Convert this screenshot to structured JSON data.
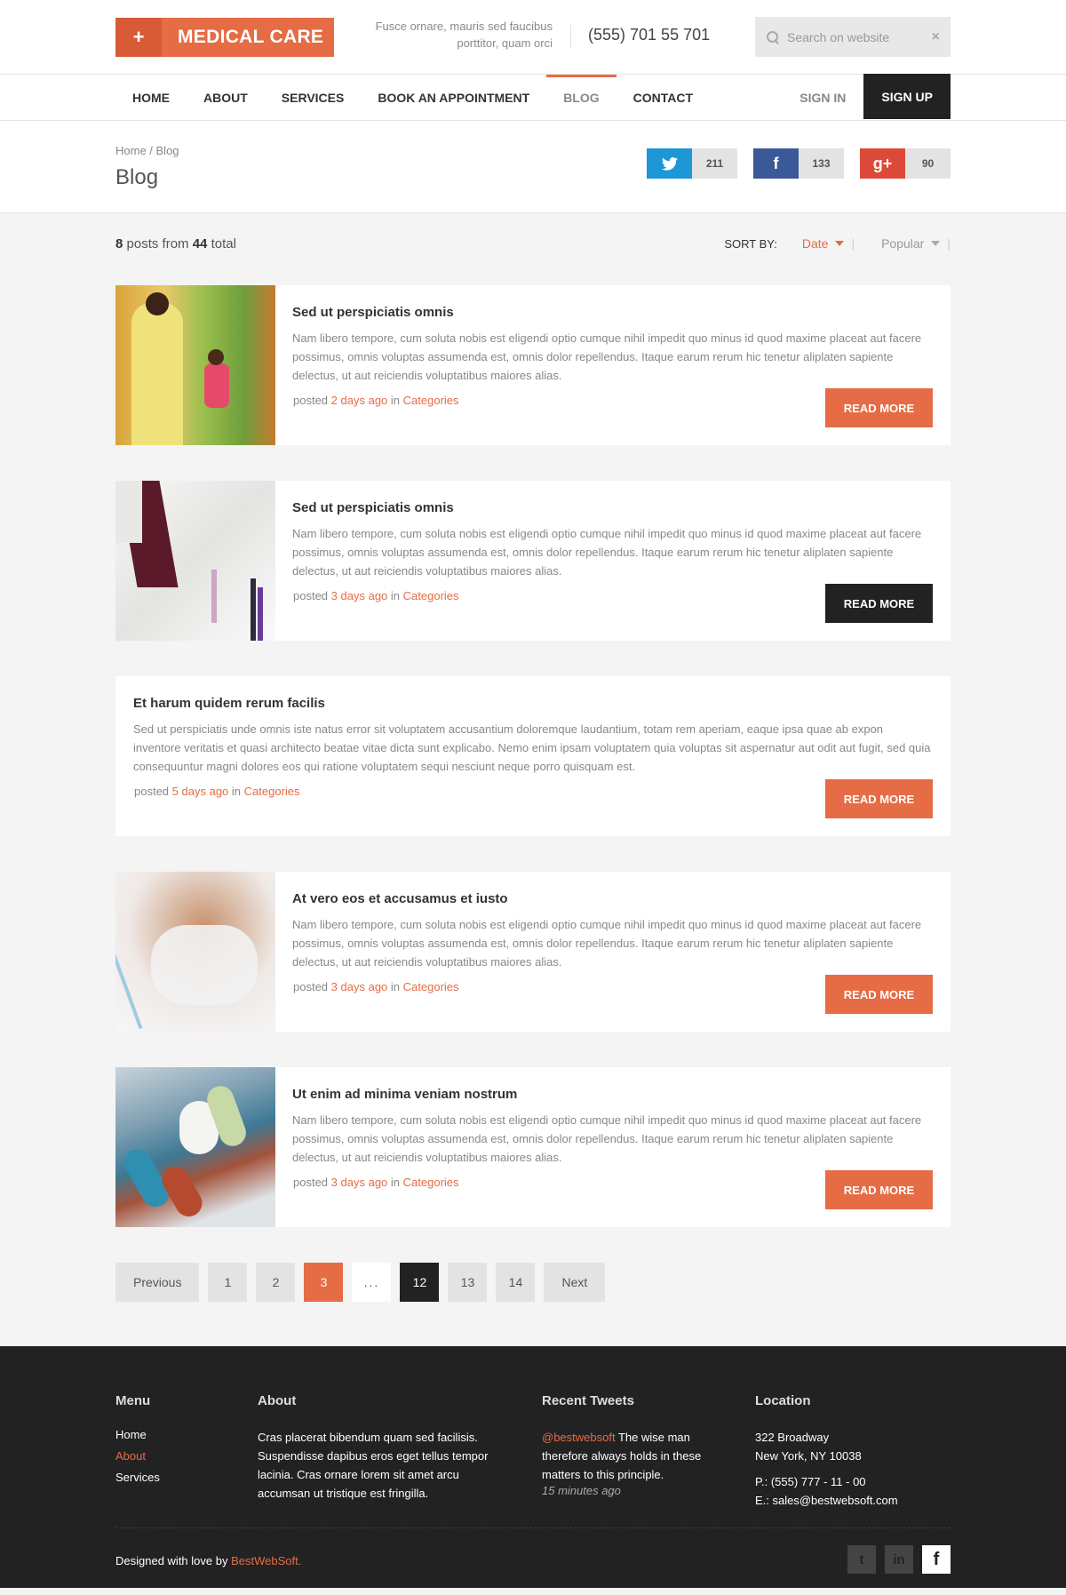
{
  "header": {
    "logo_plus": "+",
    "logo_text": "MEDICAL CARE",
    "tagline_line1": "Fusce ornare, mauris sed faucibus",
    "tagline_line2": "porttitor, quam orci",
    "phone": "(555) 701 55 701",
    "search_placeholder": "Search on website",
    "search_clear": "×"
  },
  "nav": {
    "items": [
      "HOME",
      "ABOUT",
      "SERVICES",
      "BOOK AN APPOINTMENT",
      "BLOG",
      "CONTACT"
    ],
    "active": "BLOG",
    "sign_in": "SIGN IN",
    "sign_up": "SIGN UP"
  },
  "page": {
    "breadcrumb": "Home / Blog",
    "title": "Blog"
  },
  "social": {
    "twitter": {
      "icon": "twitter-icon",
      "glyph": "t",
      "count": "211",
      "color": "#1e97d6"
    },
    "facebook": {
      "icon": "facebook-icon",
      "glyph": "f",
      "count": "133",
      "color": "#3b5898"
    },
    "google": {
      "icon": "google-plus-icon",
      "glyph": "g+",
      "count": "90",
      "color": "#db4a39"
    }
  },
  "listing": {
    "shown": "8",
    "posts_from": "posts from",
    "total": "44",
    "total_word": "total",
    "sort_label": "SORT BY:",
    "sort_options": [
      "Date",
      "Popular"
    ],
    "sort_active": "Date",
    "sep": "|"
  },
  "posts": [
    {
      "title": "Sed ut perspiciatis omnis",
      "excerpt": "Nam libero tempore, cum soluta nobis est eligendi optio cumque nihil impedit quo minus id quod maxime placeat aut facere possimus, omnis voluptas assumenda est, omnis dolor repellendus. Itaque earum rerum hic tenetur aliplaten sapiente delectus, ut aut reiciendis voluptatibus maiores alias.",
      "posted": "posted",
      "when": "2 days ago",
      "in": "in",
      "category": "Categories",
      "button": "READ MORE"
    },
    {
      "title": "Sed ut perspiciatis omnis",
      "excerpt": "Nam libero tempore, cum soluta nobis est eligendi optio cumque nihil impedit quo minus id quod maxime placeat aut facere possimus, omnis voluptas assumenda est, omnis dolor repellendus. Itaque earum rerum hic tenetur aliplaten sapiente delectus, ut aut reiciendis voluptatibus maiores alias.",
      "posted": "posted",
      "when": "3 days ago",
      "in": "in",
      "category": "Categories",
      "button": "READ MORE"
    },
    {
      "title": "Et harum quidem rerum facilis",
      "excerpt": "Sed ut perspiciatis unde omnis iste natus error sit voluptatem accusantium doloremque laudantium, totam rem aperiam, eaque ipsa quae ab expon inventore veritatis et quasi architecto beatae vitae dicta sunt explicabo. Nemo enim ipsam voluptatem quia voluptas sit aspernatur aut odit aut fugit, sed quia consequuntur magni dolores eos qui ratione voluptatem sequi nesciunt neque porro quisquam est.",
      "posted": "posted",
      "when": "5 days ago",
      "in": "in",
      "category": "Categories",
      "button": "READ MORE"
    },
    {
      "title": "At vero eos et accusamus et iusto",
      "excerpt": "Nam libero tempore, cum soluta nobis est eligendi optio cumque nihil impedit quo minus id quod maxime placeat aut facere possimus, omnis voluptas assumenda est, omnis dolor repellendus. Itaque earum rerum hic tenetur aliplaten sapiente delectus, ut aut reiciendis voluptatibus maiores alias.",
      "posted": "posted",
      "when": "3 days ago",
      "in": "in",
      "category": "Categories",
      "button": "READ MORE"
    },
    {
      "title": "Ut enim ad minima veniam nostrum",
      "excerpt": "Nam libero tempore, cum soluta nobis est eligendi optio cumque nihil impedit quo minus id quod maxime placeat aut facere possimus, omnis voluptas assumenda est, omnis dolor repellendus. Itaque earum rerum hic tenetur aliplaten sapiente delectus, ut aut reiciendis voluptatibus maiores alias.",
      "posted": "posted",
      "when": "3 days ago",
      "in": "in",
      "category": "Categories",
      "button": "READ MORE"
    }
  ],
  "pagination": {
    "previous": "Previous",
    "pages": [
      "1",
      "2",
      "3",
      "...",
      "12",
      "13",
      "14"
    ],
    "current": "3",
    "next": "Next"
  },
  "footer": {
    "menu_title": "Menu",
    "menu": [
      "Home",
      "About",
      "Services"
    ],
    "menu_active": "About",
    "about_title": "About",
    "about_text": "Cras placerat bibendum quam sed facilisis. Suspendisse dapibus eros eget tellus tempor lacinia. Cras ornare lorem sit amet arcu accumsan ut tristique est fringilla.",
    "tweets_title": "Recent Tweets",
    "tweet_handle": "@bestwebsoft",
    "tweet_text": " The wise man therefore always holds in these matters to this principle.",
    "tweet_time": "15 minutes ago",
    "location_title": "Location",
    "address1": "322 Broadway",
    "address2": "New York, NY 10038",
    "phone": "P.: (555) 777 - 11 - 00",
    "email": "E.: sales@bestwebsoft.com",
    "credits_prefix": "Designed with love by ",
    "credits_brand": "BestWebSoft.",
    "social": [
      "t",
      "in",
      "f"
    ],
    "accent": "#e56c45"
  }
}
